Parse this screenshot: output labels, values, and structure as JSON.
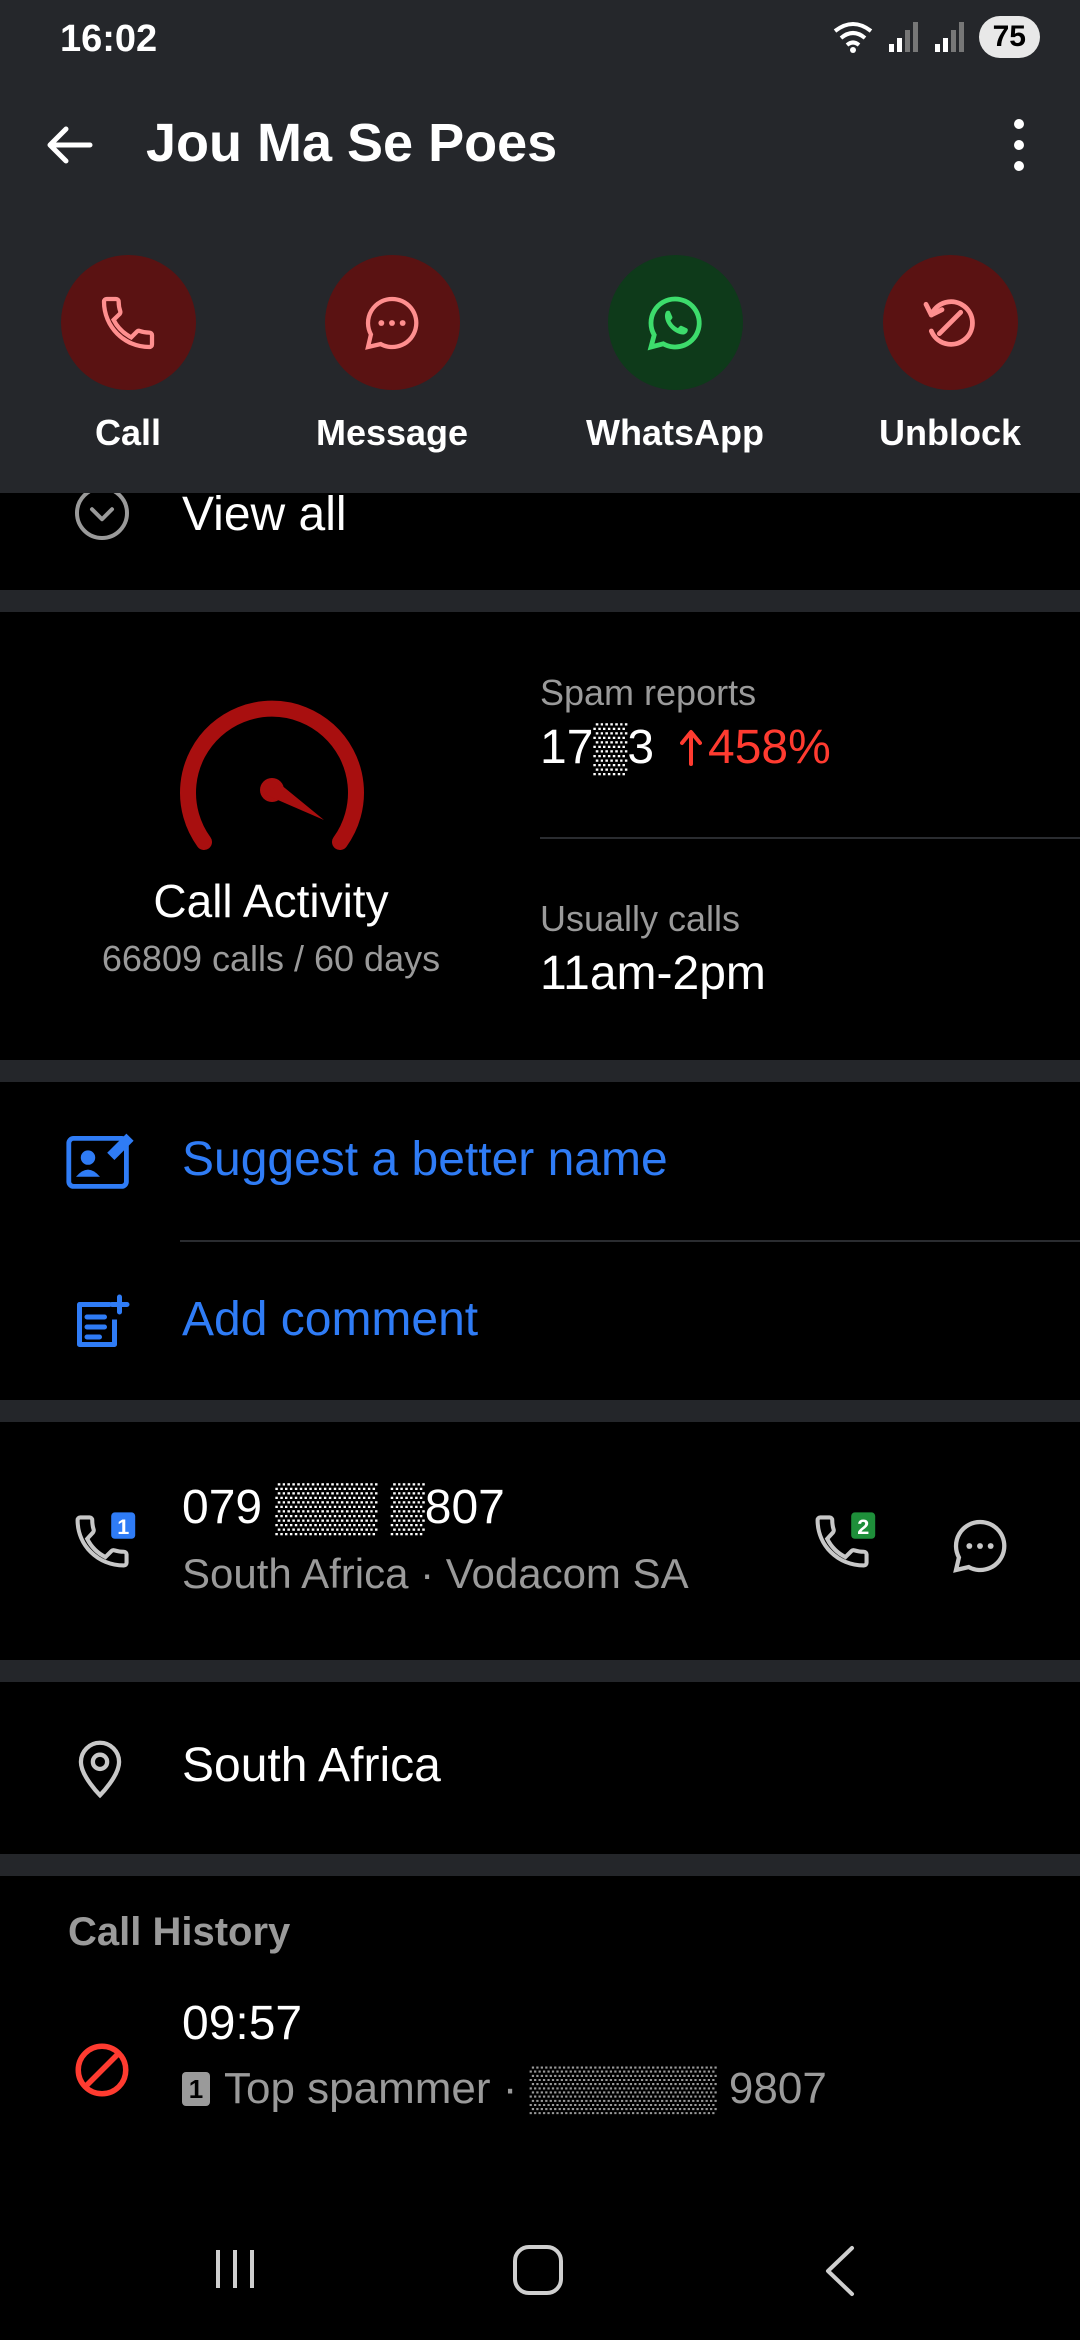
{
  "status": {
    "time": "16:02",
    "battery": "75"
  },
  "appbar": {
    "title": "Jou Ma Se Poes"
  },
  "actions": [
    {
      "label": "Call",
      "icon": "phone-icon",
      "circle": "#5a1212",
      "iconColor": "#ff8f8f"
    },
    {
      "label": "Message",
      "icon": "message-icon",
      "circle": "#5a1212",
      "iconColor": "#ff8f8f"
    },
    {
      "label": "WhatsApp",
      "icon": "whatsapp-icon",
      "circle": "#0e3a1a",
      "iconColor": "#3ddc6c"
    },
    {
      "label": "Unblock",
      "icon": "unblock-icon",
      "circle": "#5a1212",
      "iconColor": "#ff8f8f"
    }
  ],
  "view_all": {
    "label": "View all"
  },
  "stats": {
    "gauge_label": "Call Activity",
    "gauge_sub": "66809 calls / 60 days",
    "spam_reports_label": "Spam reports",
    "spam_reports_value": "17▒3",
    "spam_change": "458%",
    "usually_calls_label": "Usually calls",
    "usually_calls_value": "11am-2pm"
  },
  "suggest": {
    "label": "Suggest a better name"
  },
  "comment": {
    "label": "Add comment"
  },
  "number": {
    "value": "079 ▒▒▒ ▒807",
    "sub": "South Africa · Vodacom SA",
    "sim1": "1",
    "sim2": "2"
  },
  "location": {
    "label": "South Africa"
  },
  "history": {
    "title": "Call History",
    "time": "09:57",
    "sim": "1",
    "desc": "Top spammer · ▒▒▒▒▒▒ 9807"
  },
  "colors": {
    "accent": "#2f7cf6",
    "danger": "#ff3b30"
  }
}
